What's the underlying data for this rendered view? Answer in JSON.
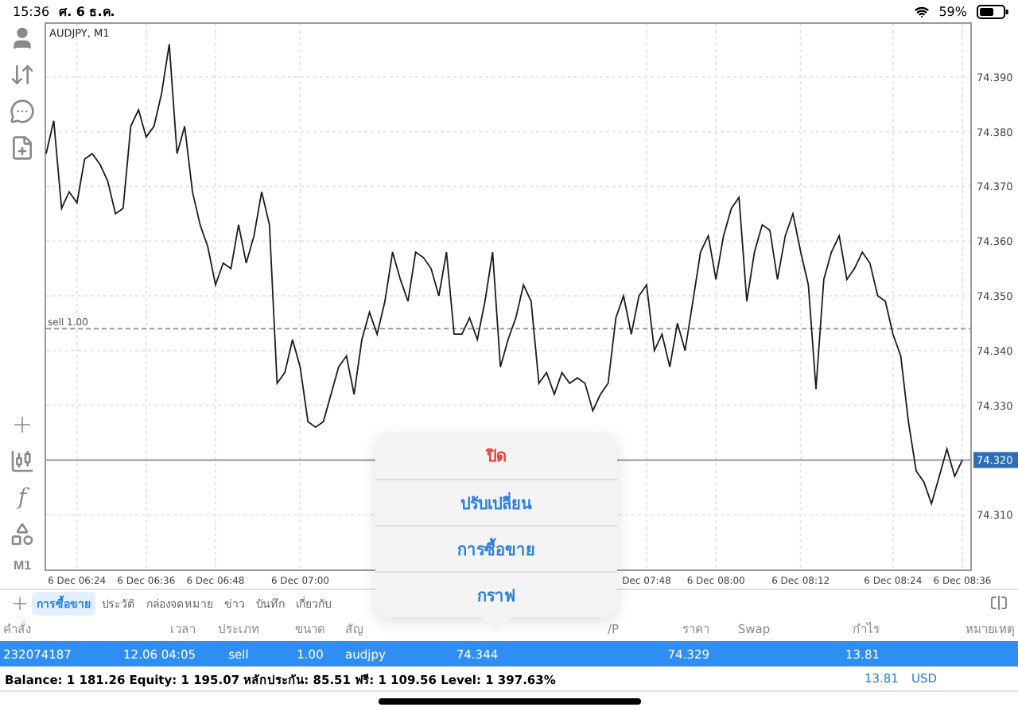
{
  "status_bar": {
    "time": "15:36",
    "date": "ศ. 6 ธ.ค.",
    "battery": "59%"
  },
  "toolbar": {
    "timeframe": "M1",
    "function_glyph": "f"
  },
  "chart": {
    "title": "AUDJPY, M1",
    "chart_data": {
      "type": "line",
      "ylim": [
        74.3,
        74.4
      ],
      "yticks": [
        {
          "value": 74.31,
          "label": "74.310"
        },
        {
          "value": 74.33,
          "label": "74.330"
        },
        {
          "value": 74.34,
          "label": "74.340"
        },
        {
          "value": 74.35,
          "label": "74.350"
        },
        {
          "value": 74.36,
          "label": "74.360"
        },
        {
          "value": 74.37,
          "label": "74.370"
        },
        {
          "value": 74.38,
          "label": "74.380"
        },
        {
          "value": 74.39,
          "label": "74.390"
        }
      ],
      "categories": [
        null,
        null,
        null,
        null,
        "6 Dec 06:24",
        null,
        null,
        null,
        null,
        null,
        null,
        null,
        null,
        "6 Dec 06:36",
        null,
        null,
        null,
        null,
        null,
        null,
        null,
        null,
        "6 Dec 06:48",
        null,
        null,
        null,
        null,
        null,
        null,
        null,
        null,
        null,
        null,
        "6 Dec 07:00",
        null,
        null,
        null,
        null,
        null,
        null,
        null,
        null,
        null,
        null,
        null,
        null,
        null,
        null,
        null,
        null,
        null,
        null,
        null,
        null,
        null,
        null,
        null,
        null,
        null,
        null,
        null,
        null,
        null,
        null,
        null,
        null,
        null,
        null,
        null,
        null,
        null,
        null,
        null,
        null,
        null,
        null,
        null,
        null,
        "Dec 07:48",
        null,
        null,
        null,
        null,
        null,
        null,
        null,
        null,
        "6 Dec 08:00",
        null,
        null,
        null,
        null,
        null,
        null,
        null,
        null,
        null,
        null,
        "6 Dec 08:12",
        null,
        null,
        null,
        null,
        null,
        null,
        null,
        null,
        null,
        null,
        null,
        "6 Dec 08:24",
        null,
        null,
        null,
        null,
        null,
        null,
        null,
        null,
        "6 Dec 08:36"
      ],
      "series": [
        {
          "color": "#1c1c1c",
          "values": [
            74.376,
            74.382,
            74.366,
            74.369,
            74.367,
            74.375,
            74.376,
            74.374,
            74.371,
            74.365,
            74.366,
            74.381,
            74.384,
            74.379,
            74.381,
            74.387,
            74.396,
            74.376,
            74.381,
            74.369,
            74.363,
            74.359,
            74.352,
            74.356,
            74.355,
            74.363,
            74.356,
            74.361,
            74.369,
            74.363,
            74.334,
            74.336,
            74.342,
            74.337,
            74.327,
            74.326,
            74.327,
            74.332,
            74.337,
            74.339,
            74.332,
            74.342,
            74.347,
            74.343,
            74.349,
            74.358,
            74.353,
            74.349,
            74.358,
            74.357,
            74.355,
            74.35,
            74.358,
            74.343,
            74.343,
            74.346,
            74.342,
            74.349,
            74.358,
            74.337,
            74.342,
            74.346,
            74.352,
            74.349,
            74.334,
            74.336,
            74.332,
            74.336,
            74.334,
            74.335,
            74.334,
            74.329,
            74.332,
            74.334,
            74.346,
            74.35,
            74.343,
            74.35,
            74.352,
            74.34,
            74.343,
            74.337,
            74.345,
            74.34,
            74.349,
            74.358,
            74.361,
            74.353,
            74.361,
            74.366,
            74.368,
            74.349,
            74.358,
            74.363,
            74.362,
            74.353,
            74.361,
            74.365,
            74.358,
            74.352,
            74.333,
            74.353,
            74.358,
            74.361,
            74.353,
            74.355,
            74.358,
            74.356,
            74.35,
            74.349,
            74.343,
            74.339,
            74.327,
            74.318,
            74.316,
            74.312,
            74.317,
            74.322,
            74.317,
            74.32
          ]
        }
      ],
      "grid": true,
      "ref_lines": [
        {
          "axis": "y",
          "value": 74.344,
          "label": "sell 1.00"
        },
        {
          "axis": "y",
          "value": 74.32,
          "label": "74.320"
        }
      ]
    }
  },
  "tabs": [
    {
      "label": "การซื้อขาย",
      "selected": true
    },
    {
      "label": "ประวัติ",
      "selected": false
    },
    {
      "label": "กล่องจดหมาย",
      "selected": false
    },
    {
      "label": "ข่าว",
      "selected": false
    },
    {
      "label": "บันทึก",
      "selected": false
    },
    {
      "label": "เกี่ยวกับ",
      "selected": false
    }
  ],
  "table": {
    "columns": {
      "order": "คำสั่ง",
      "time": "เวลา",
      "type": "ประเภท",
      "size": "ขนาด",
      "symbol": "สัญ",
      "column_8": "/P",
      "price": "ราคา",
      "swap": "Swap",
      "profit": "กำไร",
      "comment": "หมายเหตุ"
    },
    "rows": [
      {
        "order": "232074187",
        "time": "12.06 04:05",
        "type": "sell",
        "size": "1.00",
        "symbol": "audjpy",
        "column_6": "74.344",
        "price": "74.329",
        "profit": "13.81",
        "selected": true
      }
    ]
  },
  "summary": {
    "text": "Balance: 1 181.26 Equity: 1 195.07 หลักประกัน: 85.51 ฟรี: 1 109.56 Level: 1 397.63%",
    "profit": "13.81",
    "currency": "USD"
  },
  "popover": {
    "items": [
      {
        "label": "ปิด",
        "kind": "destructive"
      },
      {
        "label": "ปรับเปลี่ยน",
        "kind": "default"
      },
      {
        "label": "การซื้อขาย",
        "kind": "default"
      },
      {
        "label": "กราฟ",
        "kind": "default"
      }
    ]
  }
}
